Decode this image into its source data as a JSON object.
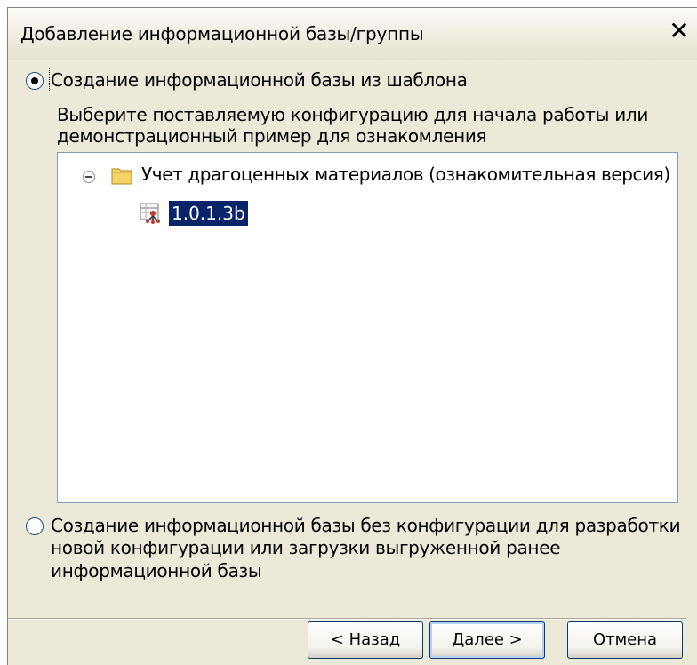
{
  "dialog": {
    "title": "Добавление информационной базы/группы",
    "close_symbol": "✕"
  },
  "option_template": {
    "label": "Создание информационной базы из шаблона",
    "selected": true,
    "description_line1": "Выберите поставляемую конфигурацию для начала работы или",
    "description_line2": "демонстрационный пример для ознакомления"
  },
  "tree": {
    "group_label": "Учет драгоценных материалов (ознакомительная версия)",
    "group_icon": "folder-icon",
    "item_label": "1.0.1.3b",
    "item_icon": "configuration-icon"
  },
  "option_empty": {
    "line1": "Создание информационной базы без конфигурации для разработки",
    "line2": "новой конфигурации или загрузки выгруженной ранее",
    "line3": "информационной базы",
    "selected": false
  },
  "buttons": {
    "back": "< Назад",
    "next": "Далее >",
    "cancel": "Отмена"
  },
  "colors": {
    "selection": "#0a246a",
    "dialog_bg": "#ece9d8",
    "button_border": "#003c74"
  }
}
